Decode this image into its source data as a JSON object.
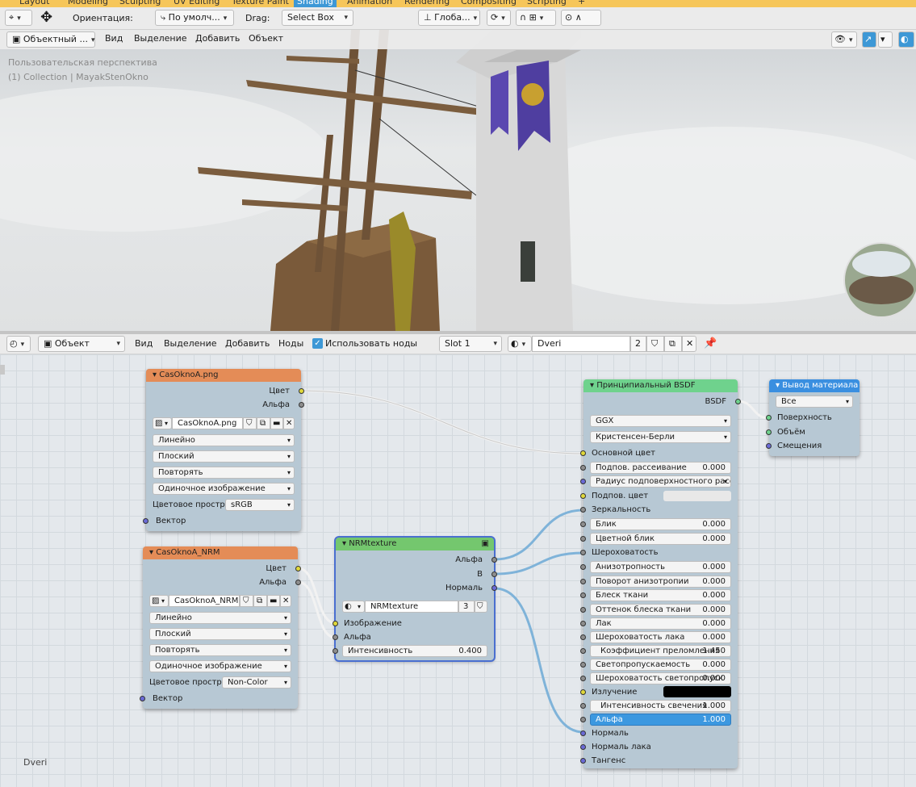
{
  "workspace_tabs": [
    "Layout",
    "Modeling",
    "Sculpting",
    "UV Editing",
    "Texture Paint",
    "Shading",
    "Animation",
    "Rendering",
    "Compositing",
    "Scripting",
    "+"
  ],
  "active_tab": "Shading",
  "top_header": {
    "orientation_label": "Ориентация:",
    "orientation_value": "По умолч...",
    "drag_label": "Drag:",
    "drag_value": "Select Box",
    "transform_space": "Глоба..."
  },
  "viewport_header": {
    "mode": "Объектный ...",
    "menus": [
      "Вид",
      "Выделение",
      "Добавить",
      "Объект"
    ]
  },
  "viewport_overlay": {
    "line1": "Пользовательская перспектива",
    "line2": "(1) Collection | MayakStenOkno"
  },
  "node_header": {
    "editor_type": "Объект",
    "menus": [
      "Вид",
      "Выделение",
      "Добавить",
      "Ноды"
    ],
    "use_nodes_label": "Использовать ноды",
    "use_nodes_checked": true,
    "slot": "Slot 1",
    "material_name": "Dveri",
    "user_count": "2"
  },
  "material_footer": "Dveri",
  "nodes": {
    "tex1": {
      "title": "CasOknoA.png",
      "out_color": "Цвет",
      "out_alpha": "Альфа",
      "image": "CasOknoA.png",
      "interpolation": "Линейно",
      "projection": "Плоский",
      "extension": "Повторять",
      "source": "Одиночное изображение",
      "colorspace_label": "Цветовое простра",
      "colorspace": "sRGB",
      "in_vector": "Вектор"
    },
    "tex2": {
      "title": "CasOknoA_NRM",
      "out_color": "Цвет",
      "out_alpha": "Альфа",
      "image": "CasOknoA_NRM",
      "interpolation": "Линейно",
      "projection": "Плоский",
      "extension": "Повторять",
      "source": "Одиночное изображение",
      "colorspace_label": "Цветовое простра",
      "colorspace": "Non-Color",
      "in_vector": "Вектор"
    },
    "group": {
      "title": "NRMtexture",
      "out_alpha": "Альфа",
      "out_b": "B",
      "out_normal": "Нормаль",
      "group_name": "NRMtexture",
      "group_users": "3",
      "in_image": "Изображение",
      "in_alpha": "Альфа",
      "intensity_label": "Интенсивность",
      "intensity_value": "0.400"
    },
    "bsdf": {
      "title": "Принципиальный BSDF",
      "out": "BSDF",
      "distribution": "GGX",
      "subsurface_method": "Кристенсен-Берли",
      "base_color": "Основной цвет",
      "subsurface_radius": "Радиус подповерхностного рассеив...",
      "subsurface_color": "Подпов. цвет",
      "specular": "Зеркальность",
      "roughness": "Шероховатость",
      "emission": "Излучение",
      "normal": "Нормаль",
      "clearcoat_normal": "Нормаль лака",
      "tangent": "Тангенс",
      "fields": [
        {
          "label": "Подпов. рассеивание",
          "value": "0.000"
        },
        {
          "label": "Блик",
          "value": "0.000"
        },
        {
          "label": "Цветной блик",
          "value": "0.000"
        },
        {
          "label": "Анизотропность",
          "value": "0.000"
        },
        {
          "label": "Поворот анизотропии",
          "value": "0.000"
        },
        {
          "label": "Блеск ткани",
          "value": "0.000"
        },
        {
          "label": "Оттенок блеска ткани",
          "value": "0.000"
        },
        {
          "label": "Лак",
          "value": "0.000"
        },
        {
          "label": "Шероховатость лака",
          "value": "0.000"
        },
        {
          "label": "Коэффициент преломления",
          "value": "1.450"
        },
        {
          "label": "Светопропускаемость",
          "value": "0.000"
        },
        {
          "label": "Шероховатость светопропуск",
          "value": "0.000"
        },
        {
          "label": "Интенсивность свечения",
          "value": "1.000"
        },
        {
          "label": "Альфа",
          "value": "1.000"
        }
      ]
    },
    "output": {
      "title": "Вывод материала",
      "target": "Все",
      "surface": "Поверхность",
      "volume": "Объём",
      "displacement": "Смещения"
    }
  },
  "colors": {
    "texture_header": "#e48c57",
    "group_header": "#74c76e",
    "shader_header": "#6fd28d",
    "output_header": "#3a8fe0",
    "node_body": "#b7c8d4",
    "active_tab": "#3d98d6",
    "highlight_field": "#3c98e0"
  }
}
